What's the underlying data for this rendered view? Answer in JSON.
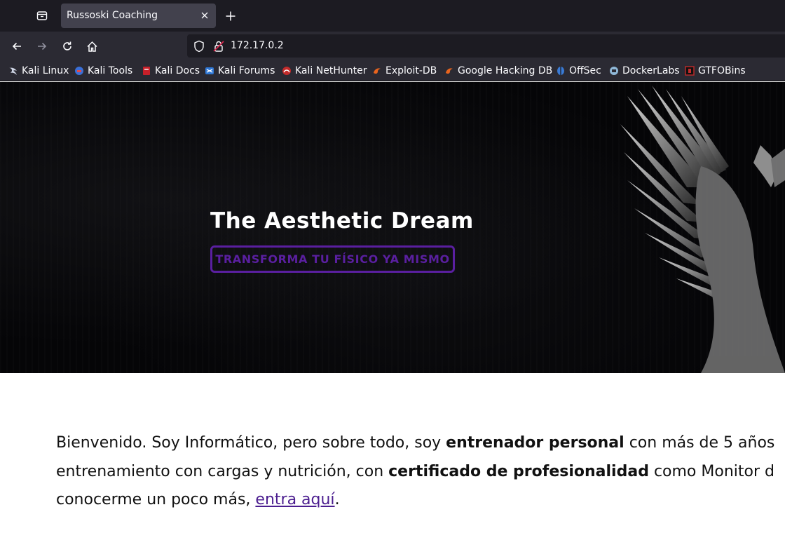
{
  "browser": {
    "tab_title": "Russoski Coaching",
    "url": "172.17.0.2",
    "bookmarks": [
      {
        "label": "Kali Linux",
        "icon": "kali-dragon-icon"
      },
      {
        "label": "Kali Tools",
        "icon": "kali-tools-icon"
      },
      {
        "label": "Kali Docs",
        "icon": "kali-docs-icon"
      },
      {
        "label": "Kali Forums",
        "icon": "kali-forums-icon"
      },
      {
        "label": "Kali NetHunter",
        "icon": "nethunter-icon"
      },
      {
        "label": "Exploit-DB",
        "icon": "exploit-db-icon"
      },
      {
        "label": "Google Hacking DB",
        "icon": "ghdb-icon"
      },
      {
        "label": "OffSec",
        "icon": "offsec-icon"
      },
      {
        "label": "DockerLabs",
        "icon": "dockerlabs-icon"
      },
      {
        "label": "GTFOBins",
        "icon": "gtfobins-icon"
      }
    ]
  },
  "hero": {
    "title": "The Aesthetic Dream",
    "cta_label": "TRANSFORMA TU FÍSICO YA MISMO"
  },
  "intro": {
    "line1_a": "Bienvenido. Soy Informático, pero sobre todo, soy ",
    "line1_b": "entrenador personal",
    "line1_c": " con más de 5 años",
    "line2_a": "entrenamiento con cargas y nutrición, con ",
    "line2_b": "certificado de profesionalidad",
    "line2_c": " como Monitor d",
    "line3_a": "conocerme un poco más, ",
    "line3_link": "entra aquí",
    "line3_b": "."
  },
  "colors": {
    "accent": "#5a1fa0",
    "hero_bg": "#050507",
    "chrome_dark": "#1c1b22",
    "chrome": "#2b2a33"
  }
}
